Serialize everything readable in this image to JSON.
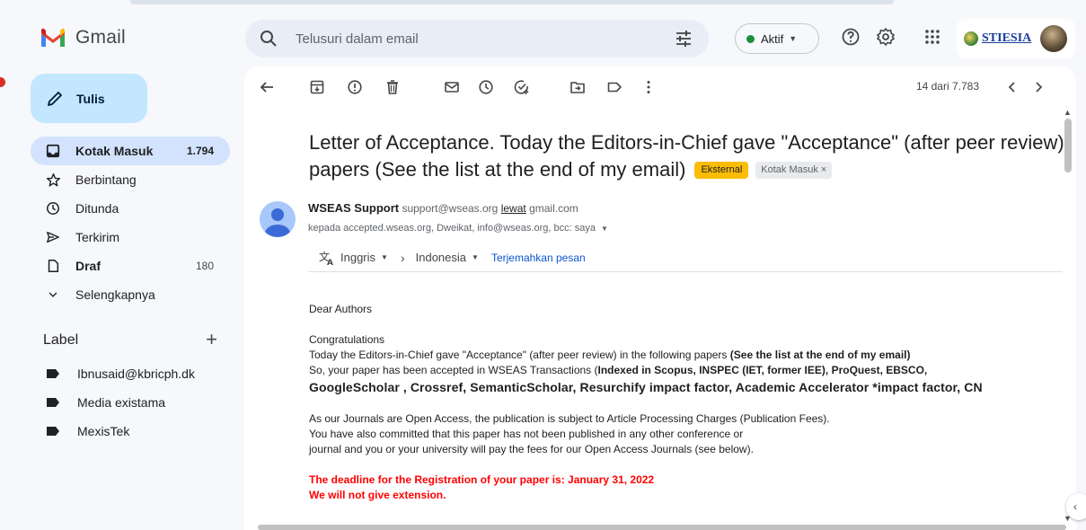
{
  "app": {
    "name": "Gmail"
  },
  "search": {
    "placeholder": "Telusuri dalam email"
  },
  "status": {
    "label": "Aktif"
  },
  "account": {
    "org_name": "STIESIA"
  },
  "compose": {
    "label": "Tulis"
  },
  "nav": [
    {
      "label": "Kotak Masuk",
      "count": "1.794",
      "icon": "inbox-icon"
    },
    {
      "label": "Berbintang",
      "count": "",
      "icon": "star-icon"
    },
    {
      "label": "Ditunda",
      "count": "",
      "icon": "clock-icon"
    },
    {
      "label": "Terkirim",
      "count": "",
      "icon": "send-icon"
    },
    {
      "label": "Draf",
      "count": "180",
      "icon": "draft-icon"
    },
    {
      "label": "Selengkapnya",
      "count": "",
      "icon": "chevron-down-icon"
    }
  ],
  "labels": {
    "title": "Label",
    "items": [
      "Ibnusaid@kbricph.dk",
      "Media existama",
      "MexisTek"
    ]
  },
  "toolbar": {
    "pager": "14 dari 7.783"
  },
  "email": {
    "subject_line1": "Letter of Acceptance. Today the Editors-in-Chief gave \"Acceptance\" (after peer review)",
    "subject_line2": "papers (See the list at the end of my email)",
    "chip_external": "Eksternal",
    "chip_inbox": "Kotak Masuk",
    "sender_name": "WSEAS Support",
    "sender_email": "support@wseas.org",
    "via_label": "lewat",
    "via_domain": "gmail.com",
    "recipients": "kepada accepted.wseas.org, Dweikat, info@wseas.org, bcc: saya",
    "translate_from": "Inggris",
    "translate_to": "Indonesia",
    "translate_link": "Terjemahkan pesan",
    "greeting": "Dear Authors",
    "congrats": "Congratulations",
    "line_editors_a": "Today the Editors-in-Chief gave \"Acceptance\" (after peer review) in the following papers ",
    "line_editors_b": "(See the list at the end of my email)",
    "line_accepted_a": "So, your paper has been accepted in WSEAS Transactions (",
    "line_accepted_b": "Indexed in Scopus, INSPEC (IET, former IEE), ProQuest, EBSCO,",
    "line_indexes": "GoogleScholar , Crossref, SemanticScholar, Resurchify impact factor, Academic Accelerator *impact factor, CN",
    "para_oa_1": "As our Journals are Open Access, the publication is subject to Article Processing Charges (Publication Fees).",
    "para_oa_2": "You have also committed  that this paper has not been published in any other conference or",
    "para_oa_3": "journal and you or your university will pay the fees for our Open Access Journals (see below).",
    "deadline": "The deadline for the Registration of your paper is:  January 31, 2022",
    "no_extension": "We will not give extension."
  },
  "colors": {
    "compose_bg": "#c2e7ff",
    "active_nav_bg": "#d3e3fd",
    "chip_external": "#fbbc04",
    "status_green": "#1e8e3e",
    "deadline_red": "#ff0000"
  }
}
